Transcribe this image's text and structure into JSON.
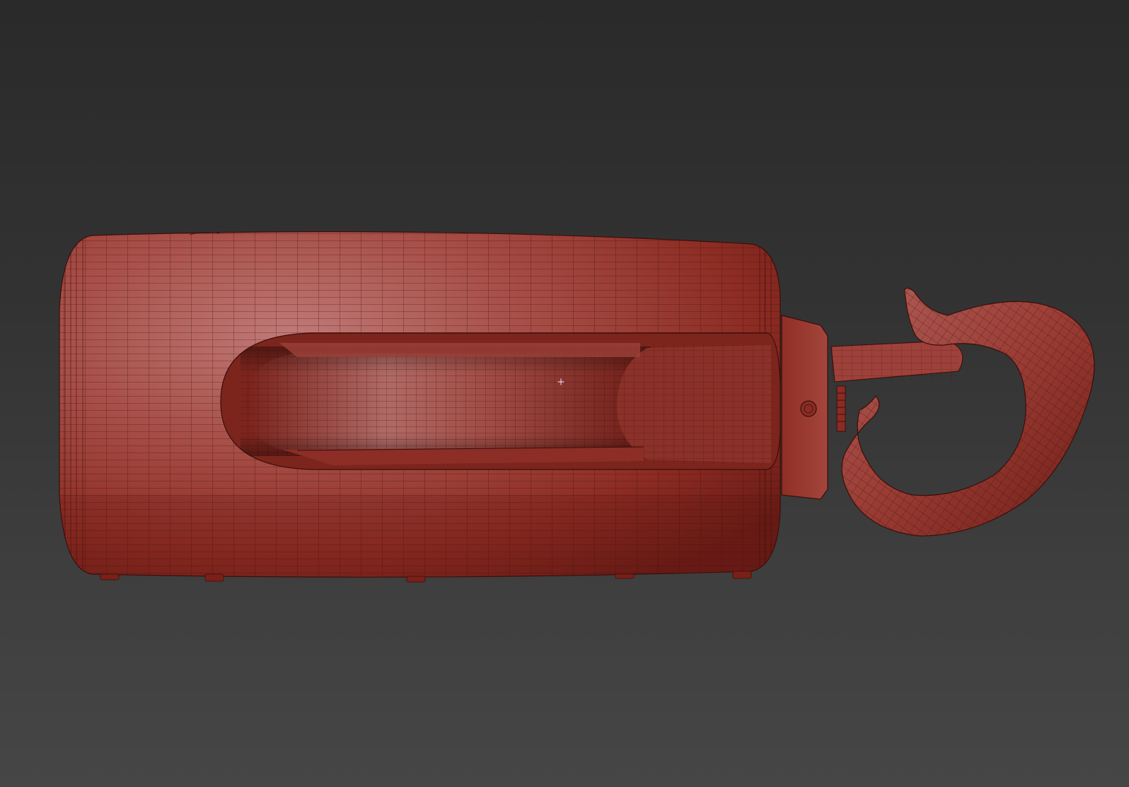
{
  "viewport": {
    "background_top": "#2a2a2a",
    "background_bottom": "#464646",
    "shading": "smooth-with-wireframe"
  },
  "model": {
    "object": "portable-speaker-with-carabiner-hook",
    "color_base": "#a0453c",
    "color_highlight": "#c07a78",
    "color_shadow": "#6b1c16",
    "wire_color": "#3a0e0a"
  },
  "cursor": {
    "icon": "crosshair-icon"
  }
}
